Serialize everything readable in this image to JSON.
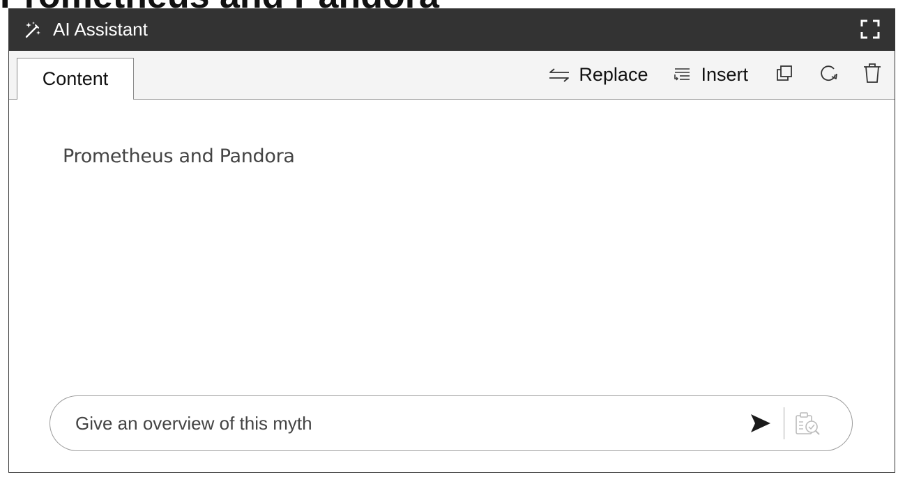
{
  "background": {
    "title": "Prometheus and Pandora"
  },
  "assistant": {
    "title": "AI Assistant",
    "icons": {
      "title_icon": "magic-wand-icon",
      "expand": "expand-icon"
    },
    "colors": {
      "titlebar_bg": "#333333",
      "tabbar_bg": "#f4f4f4",
      "text": "#111111"
    }
  },
  "tabs": [
    {
      "label": "Content",
      "active": true
    }
  ],
  "toolbar": {
    "replace_label": "Replace",
    "insert_label": "Insert",
    "icons": [
      "swap-arrows-icon",
      "insert-lines-icon",
      "copy-icon",
      "refresh-icon",
      "trash-icon"
    ]
  },
  "content": {
    "text": "Prometheus and Pandora"
  },
  "prompt": {
    "value": "Give an overview of this myth",
    "icons": [
      "send-icon",
      "review-icon"
    ]
  }
}
